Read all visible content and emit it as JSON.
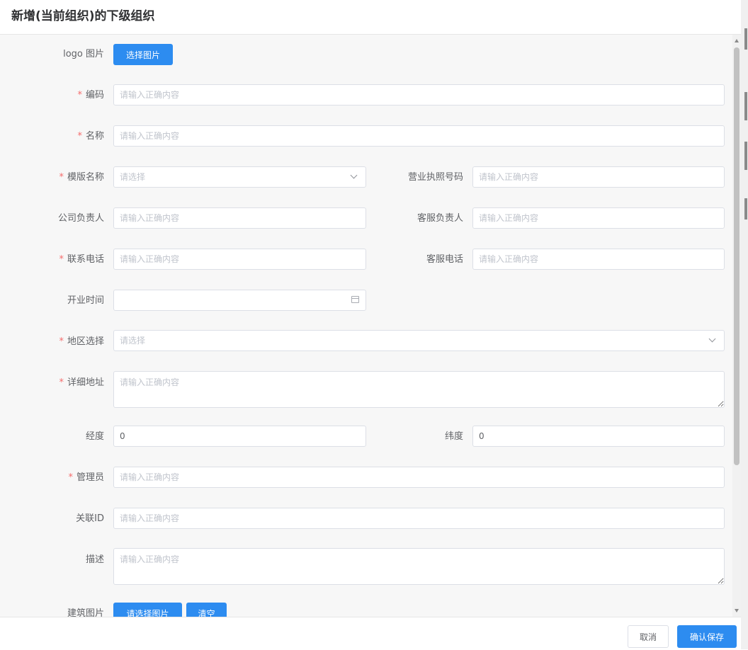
{
  "dialog": {
    "title": "新增(当前组织)的下级组织"
  },
  "form": {
    "logo_label": "logo 图片",
    "logo_button": "选择图片",
    "code_label": "编码",
    "code_placeholder": "请输入正确内容",
    "name_label": "名称",
    "name_placeholder": "请输入正确内容",
    "template_label": "模版名称",
    "template_placeholder": "请选择",
    "license_label": "营业执照号码",
    "license_placeholder": "请输入正确内容",
    "company_owner_label": "公司负责人",
    "company_owner_placeholder": "请输入正确内容",
    "service_owner_label": "客服负责人",
    "service_owner_placeholder": "请输入正确内容",
    "phone_label": "联系电话",
    "phone_placeholder": "请输入正确内容",
    "service_phone_label": "客服电话",
    "service_phone_placeholder": "请输入正确内容",
    "open_time_label": "开业时间",
    "region_label": "地区选择",
    "region_placeholder": "请选择",
    "address_label": "详细地址",
    "address_placeholder": "请输入正确内容",
    "longitude_label": "经度",
    "longitude_value": "0",
    "latitude_label": "纬度",
    "latitude_value": "0",
    "admin_label": "管理员",
    "admin_placeholder": "请输入正确内容",
    "relation_id_label": "关联ID",
    "relation_id_placeholder": "请输入正确内容",
    "description_label": "描述",
    "description_placeholder": "请输入正确内容",
    "building_images_label": "建筑图片",
    "select_images_button": "请选择图片",
    "clear_button": "清空",
    "required_mark": "*"
  },
  "footer": {
    "cancel_label": "取消",
    "confirm_label": "确认保存"
  },
  "icons": {
    "dropdown": "chevron-down-icon",
    "date": "calendar-icon"
  },
  "colors": {
    "primary": "#2d8cf0",
    "required": "#f56c6c",
    "placeholder": "#c0c4cc",
    "body_bg": "#f7f7f7",
    "border": "#dcdfe6"
  }
}
